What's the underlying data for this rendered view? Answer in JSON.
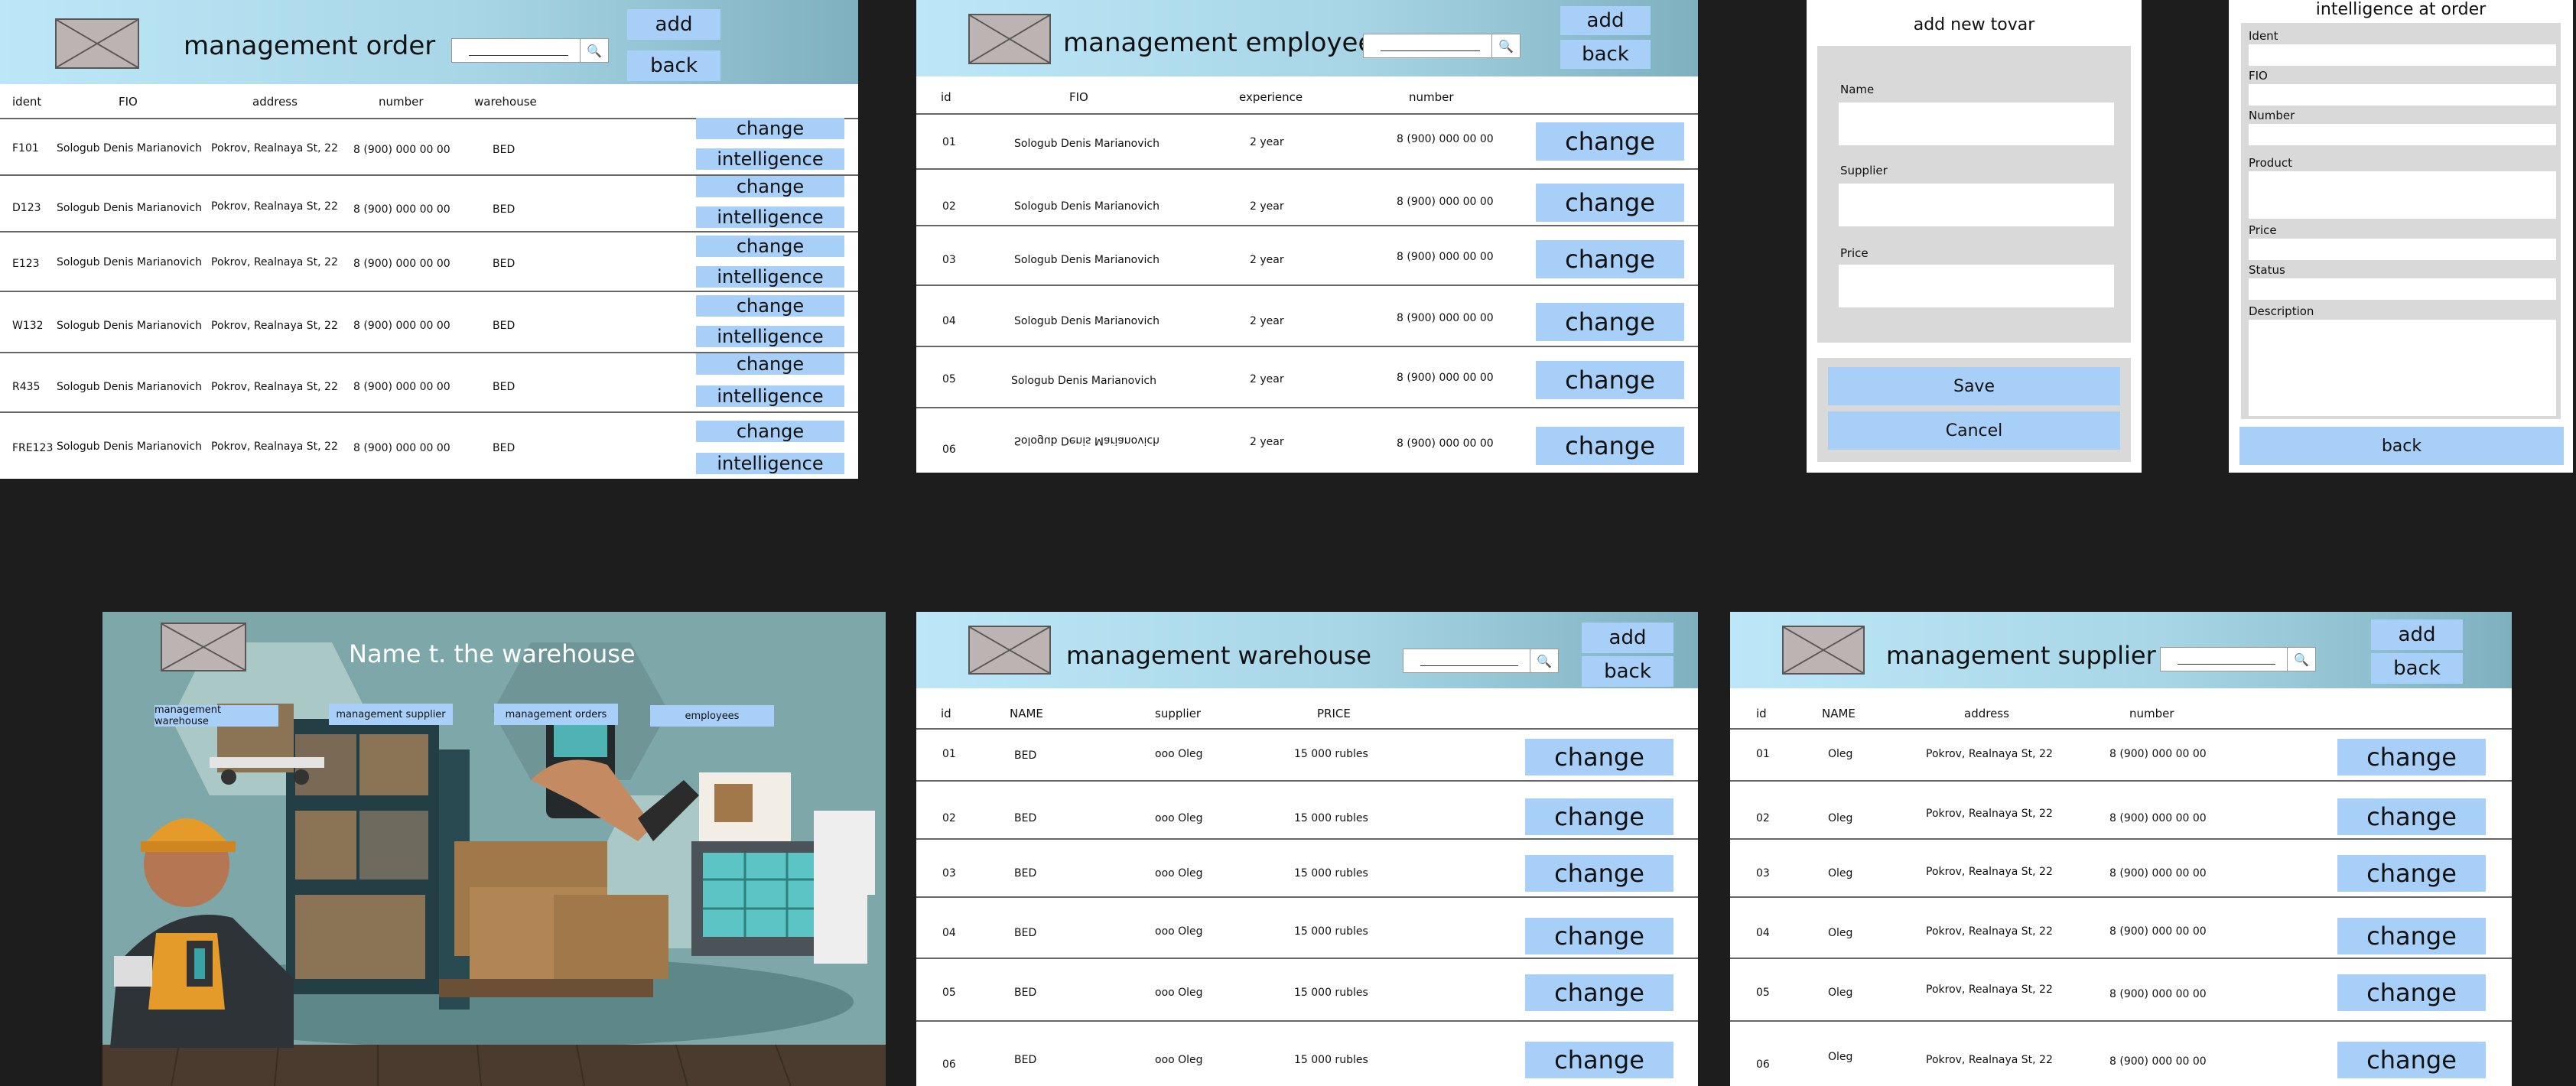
{
  "order": {
    "title": "management order",
    "add": "add",
    "back": "back",
    "search_icon": "magnifier-icon",
    "cols": [
      "ident",
      "FIO",
      "address",
      "number",
      "warehouse"
    ],
    "rows": [
      {
        "id": "F101",
        "fio": "Sologub Denis Marianovich",
        "address": "Pokrov, Realnaya St, 22",
        "number": "8 (900) 000 00 00",
        "wh": "BED"
      },
      {
        "id": "D123",
        "fio": "Sologub Denis Marianovich",
        "address": "Pokrov, Realnaya St, 22",
        "number": "8 (900) 000 00 00",
        "wh": "BED"
      },
      {
        "id": "E123",
        "fio": "Sologub Denis Marianovich",
        "address": "Pokrov, Realnaya St, 22",
        "number": "8 (900) 000 00 00",
        "wh": "BED"
      },
      {
        "id": "W132",
        "fio": "Sologub Denis Marianovich",
        "address": "Pokrov, Realnaya St, 22",
        "number": "8 (900) 000 00 00",
        "wh": "BED"
      },
      {
        "id": "R435",
        "fio": "Sologub Denis Marianovich",
        "address": "Pokrov, Realnaya St, 22",
        "number": "8 (900) 000 00 00",
        "wh": "BED"
      },
      {
        "id": "FRE123",
        "fio": "Sologub Denis Marianovich",
        "address": "Pokrov, Realnaya St, 22",
        "number": "8 (900) 000 00 00",
        "wh": "BED"
      }
    ],
    "change": "change",
    "intelligence": "intelligence"
  },
  "employees": {
    "title": "management employees",
    "add": "add",
    "back": "back",
    "cols": [
      "id",
      "FIO",
      "experience",
      "number"
    ],
    "rows": [
      {
        "id": "01",
        "fio": "Sologub Denis Marianovich",
        "exp": "2 year",
        "number": "8 (900) 000 00 00"
      },
      {
        "id": "02",
        "fio": "Sologub Denis Marianovich",
        "exp": "2 year",
        "number": "8 (900) 000 00 00"
      },
      {
        "id": "03",
        "fio": "Sologub Denis Marianovich",
        "exp": "2 year",
        "number": "8 (900) 000 00 00"
      },
      {
        "id": "04",
        "fio": "Sologub Denis Marianovich",
        "exp": "2 year",
        "number": "8 (900) 000 00 00"
      },
      {
        "id": "05",
        "fio": "Sologub Denis Marianovich",
        "exp": "2 year",
        "number": "8 (900) 000 00 00"
      },
      {
        "id": "06",
        "fio": "Sologub Denis Marianovich",
        "exp": "2 year",
        "number": "8 (900) 000 00 00"
      }
    ],
    "change": "change"
  },
  "add_tovar": {
    "title": "add new tovar",
    "fields": [
      "Name",
      "Supplier",
      "Price"
    ],
    "save": "Save",
    "cancel": "Cancel"
  },
  "intel_order": {
    "title": "intelligence at order",
    "fields": [
      "Ident",
      "FIO",
      "Number",
      "Product",
      "Price",
      "Status",
      "Description"
    ],
    "back": "back"
  },
  "home": {
    "title": "Name t. the  warehouse",
    "nav": [
      "management warehouse",
      "management supplier",
      "management orders",
      "employees"
    ]
  },
  "warehouse": {
    "title": "management warehouse",
    "add": "add",
    "back": "back",
    "cols": [
      "id",
      "NAME",
      "supplier",
      "PRICE"
    ],
    "rows": [
      {
        "id": "01",
        "name": "BED",
        "supplier": "ooo Oleg",
        "price": "15 000 rubles"
      },
      {
        "id": "02",
        "name": "BED",
        "supplier": "ooo Oleg",
        "price": "15 000 rubles"
      },
      {
        "id": "03",
        "name": "BED",
        "supplier": "ooo Oleg",
        "price": "15 000 rubles"
      },
      {
        "id": "04",
        "name": "BED",
        "supplier": "ooo Oleg",
        "price": "15 000 rubles"
      },
      {
        "id": "05",
        "name": "BED",
        "supplier": "ooo Oleg",
        "price": "15 000 rubles"
      },
      {
        "id": "06",
        "name": "BED",
        "supplier": "ooo Oleg",
        "price": "15 000 rubles"
      }
    ],
    "change": "change"
  },
  "supplier": {
    "title": "management supplier",
    "add": "add",
    "back": "back",
    "cols": [
      "id",
      "NAME",
      "address",
      "number"
    ],
    "rows": [
      {
        "id": "01",
        "name": "Oleg",
        "address": "Pokrov, Realnaya St, 22",
        "number": "8 (900) 000 00 00"
      },
      {
        "id": "02",
        "name": "Oleg",
        "address": "Pokrov, Realnaya St, 22",
        "number": "8 (900) 000 00 00"
      },
      {
        "id": "03",
        "name": "Oleg",
        "address": "Pokrov, Realnaya St, 22",
        "number": "8 (900) 000 00 00"
      },
      {
        "id": "04",
        "name": "Oleg",
        "address": "Pokrov, Realnaya St, 22",
        "number": "8 (900) 000 00 00"
      },
      {
        "id": "05",
        "name": "Oleg",
        "address": "Pokrov, Realnaya St, 22",
        "number": "8 (900) 000 00 00"
      },
      {
        "id": "06",
        "name": "Oleg",
        "address": "Pokrov, Realnaya St, 22",
        "number": "8 (900) 000 00 00"
      }
    ],
    "change": "change"
  }
}
